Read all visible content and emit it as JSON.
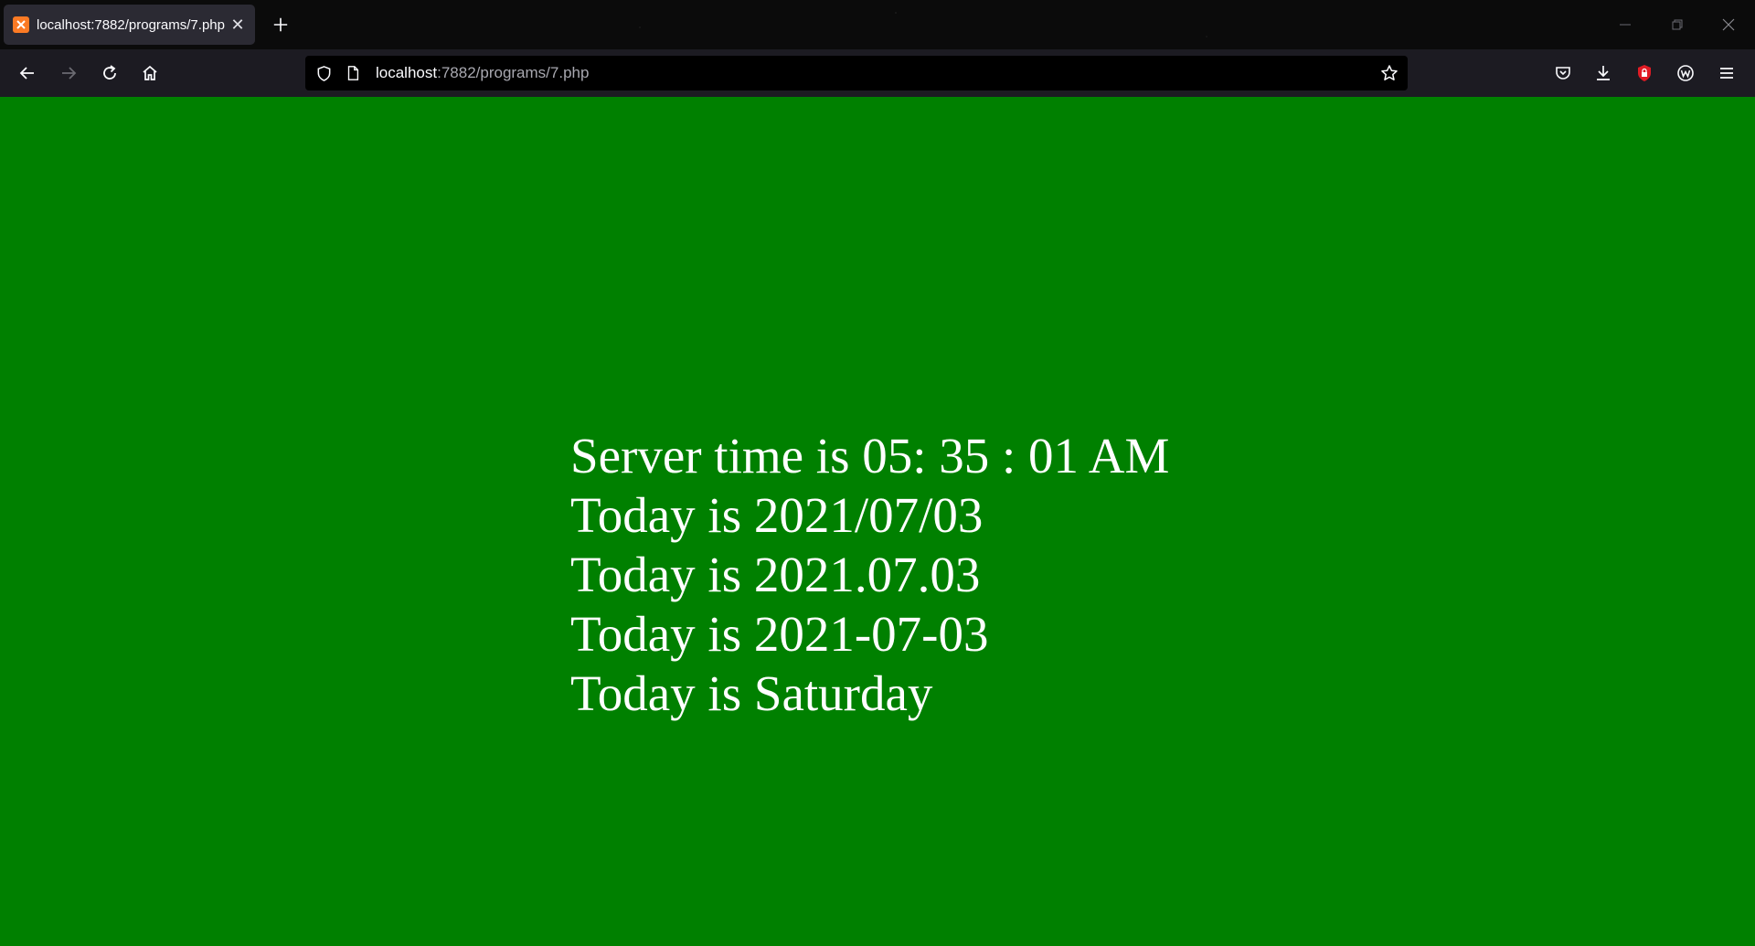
{
  "browser": {
    "tab": {
      "title": "localhost:7882/programs/7.php",
      "close_glyph": "✕",
      "favicon": "xampp-icon"
    },
    "new_tab_glyph": "+",
    "address": {
      "host": "localhost",
      "rest": ":7882/programs/7.php"
    },
    "colors": {
      "tab_bg": "#2b2a33",
      "toolbar_bg": "#1c1b22",
      "urlbar_bg": "#000000",
      "favicon": "#fb7a24",
      "extension_red": "#e01b24"
    }
  },
  "page": {
    "background": "#008000",
    "text_color": "#ffffff",
    "lines": [
      "Server time is 05: 35 : 01 AM",
      "Today is 2021/07/03",
      "Today is 2021.07.03",
      "Today is 2021-07-03",
      "Today is Saturday"
    ]
  }
}
